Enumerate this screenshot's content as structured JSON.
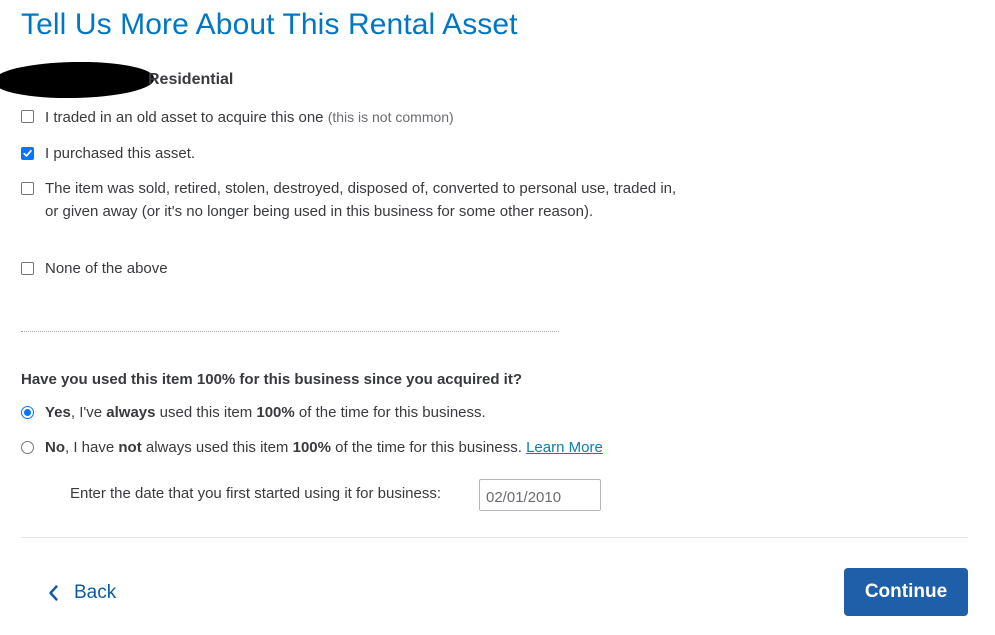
{
  "page": {
    "title": "Tell Us More About This Rental Asset"
  },
  "asset": {
    "name": "Residential"
  },
  "checkboxes": [
    {
      "label": "I traded in an old asset to acquire this one",
      "note": "(this is not common)",
      "checked": false
    },
    {
      "label": "I purchased this asset.",
      "checked": true
    },
    {
      "label": "The item was sold, retired, stolen, destroyed, disposed of, converted to personal use, traded in, or given away (or it's no longer being used in this business for some other reason).",
      "checked": false
    },
    {
      "label": "None of the above",
      "checked": false
    }
  ],
  "usage_question": {
    "question": "Have you used this item 100% for this business since you acquired it?",
    "yes": {
      "word": "Yes",
      "part1": ", I've ",
      "bold1": "always",
      "part2": " used this item ",
      "bold2": "100%",
      "part3": " of the time for this business.",
      "selected": true
    },
    "no": {
      "word": "No",
      "part1": ", I have ",
      "bold1": "not",
      "part2": " always used this item ",
      "bold2": "100%",
      "part3": " of the time for this business. ",
      "link": "Learn More",
      "selected": false
    }
  },
  "business_date": {
    "label": "Enter the date that you first started using it for business:",
    "value": "02/01/2010"
  },
  "footer": {
    "back_label": "Back",
    "continue_label": "Continue"
  },
  "colors": {
    "title": "#0077c5",
    "primary_button": "#1f5ea8",
    "link": "#0d7fa8",
    "checkbox_accent": "#0075ff"
  }
}
